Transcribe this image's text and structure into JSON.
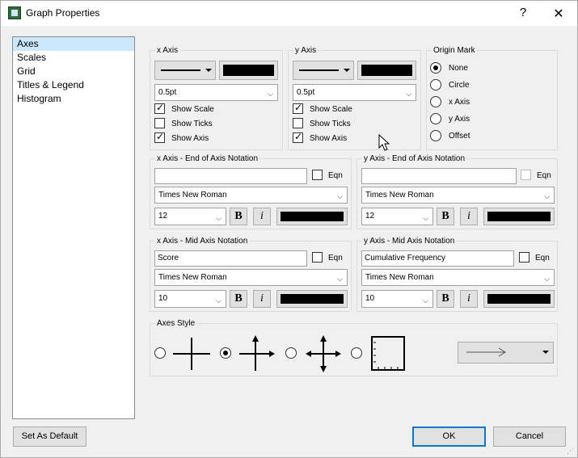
{
  "window": {
    "title": "Graph Properties",
    "help_label": "?",
    "close_label": "✕"
  },
  "sidebar": {
    "items": [
      {
        "label": "Axes"
      },
      {
        "label": "Scales"
      },
      {
        "label": "Grid"
      },
      {
        "label": "Titles & Legend"
      },
      {
        "label": "Histogram"
      }
    ]
  },
  "x_axis": {
    "title": "x Axis",
    "line_weight": "0.5pt",
    "show_scale": "Show Scale",
    "show_ticks": "Show Ticks",
    "show_axis": "Show Axis",
    "show_scale_checked": true,
    "show_ticks_checked": false,
    "show_axis_checked": true
  },
  "y_axis": {
    "title": "y Axis",
    "line_weight": "0.5pt",
    "show_scale": "Show Scale",
    "show_ticks": "Show Ticks",
    "show_axis": "Show Axis",
    "show_scale_checked": true,
    "show_ticks_checked": false,
    "show_axis_checked": true
  },
  "origin_mark": {
    "title": "Origin Mark",
    "options": [
      "None",
      "Circle",
      "x Axis",
      "y Axis",
      "Offset"
    ],
    "selected": "None"
  },
  "x_end": {
    "title": "x Axis - End of Axis Notation",
    "text": "",
    "eqn": "Eqn",
    "font": "Times New Roman",
    "size": "12",
    "bold": "B",
    "italic": "i"
  },
  "y_end": {
    "title": "y Axis - End of Axis Notation",
    "text": "",
    "eqn": "Eqn",
    "font": "Times New Roman",
    "size": "12",
    "bold": "B",
    "italic": "i"
  },
  "x_mid": {
    "title": "x Axis - Mid Axis Notation",
    "text": "Score",
    "eqn": "Eqn",
    "font": "Times New Roman",
    "size": "10",
    "bold": "B",
    "italic": "i"
  },
  "y_mid": {
    "title": "y Axis - Mid Axis Notation",
    "text": "Cumulative Frequency",
    "eqn": "Eqn",
    "font": "Times New Roman",
    "size": "10",
    "bold": "B",
    "italic": "i"
  },
  "axes_style": {
    "title": "Axes Style",
    "selected_index": 1
  },
  "buttons": {
    "set_default": "Set As Default",
    "ok": "OK",
    "cancel": "Cancel"
  },
  "colors": {
    "selection": "#cce8ff",
    "swatch": "#000000"
  }
}
